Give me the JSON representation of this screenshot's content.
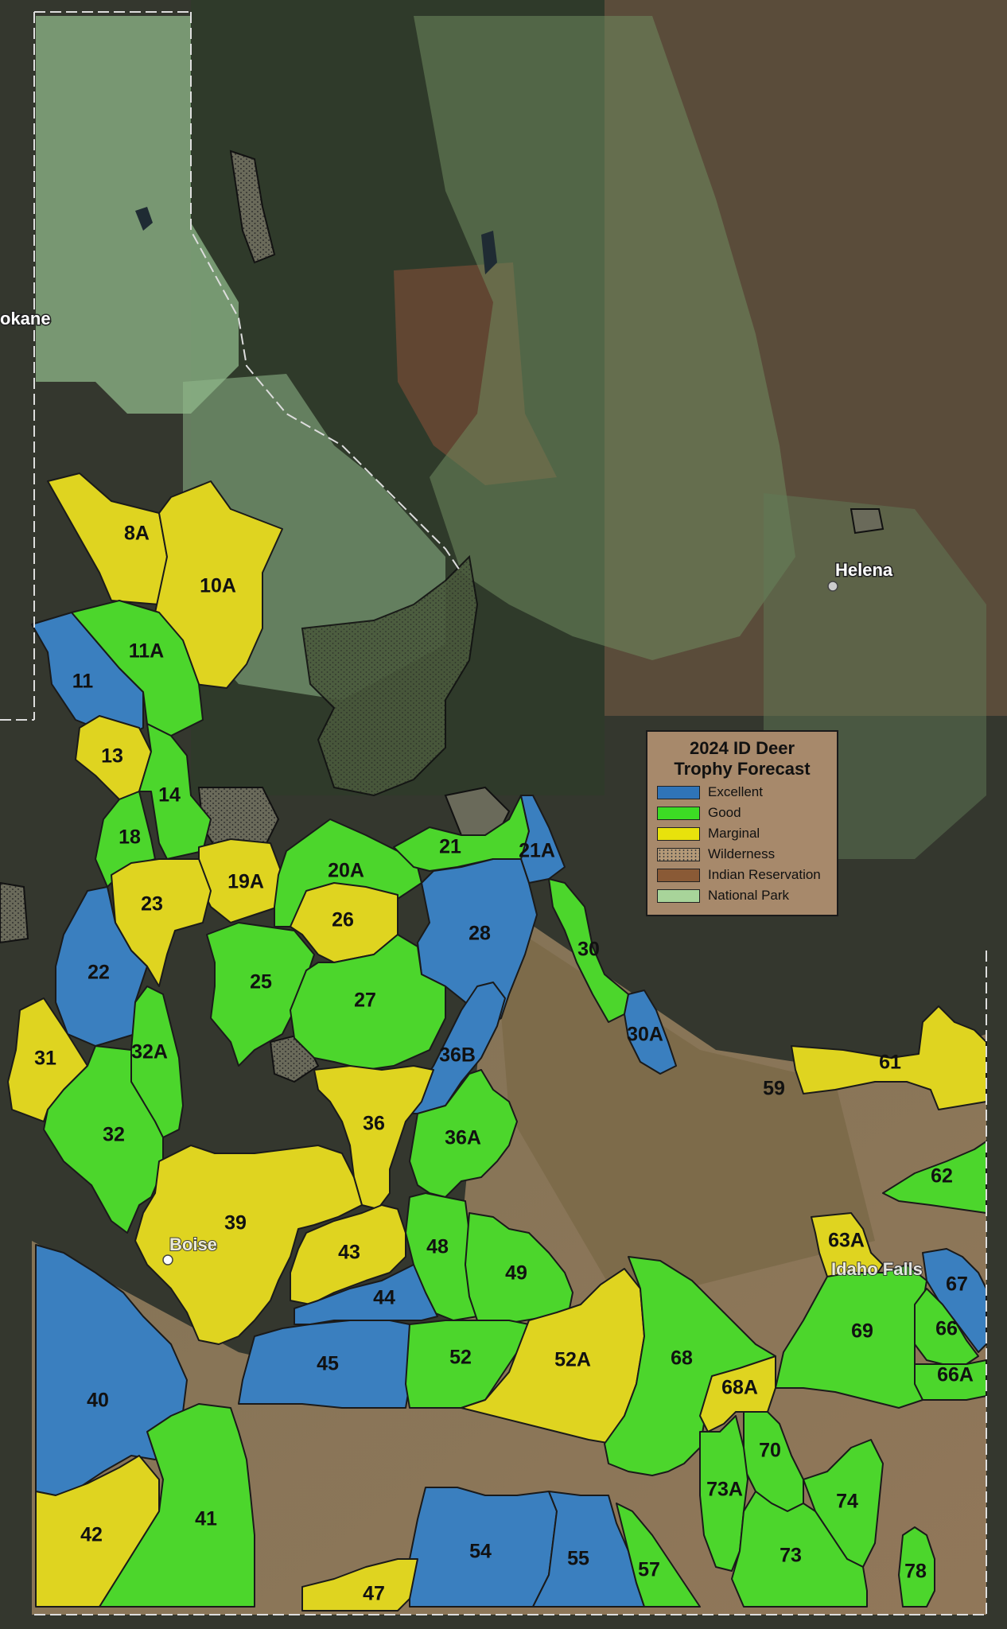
{
  "legend": {
    "title_line1": "2024 ID Deer",
    "title_line2": "Trophy Forecast",
    "items": [
      {
        "label": "Excellent",
        "color": "#2f74b8"
      },
      {
        "label": "Good",
        "color": "#3cdc24"
      },
      {
        "label": "Marginal",
        "color": "#e8e20c"
      },
      {
        "label": "Wilderness",
        "color": "#b59a78"
      },
      {
        "label": "Indian Reservation",
        "color": "#8a5a36"
      },
      {
        "label": "National Park",
        "color": "#a8d49a"
      }
    ]
  },
  "cities": {
    "spokane": "okane",
    "helena": "Helena",
    "boise": "Boise",
    "idaho_falls": "Idaho Falls"
  },
  "colors": {
    "excellent": "#3a7fbf",
    "good": "#4cd62c",
    "marginal": "#dfd420",
    "national_forest_overlay": "#8fb88a",
    "background": "#3b3d33"
  },
  "units": [
    {
      "id": "8A",
      "rating": "marginal"
    },
    {
      "id": "10A",
      "rating": "marginal"
    },
    {
      "id": "11A",
      "rating": "good"
    },
    {
      "id": "11",
      "rating": "excellent"
    },
    {
      "id": "13",
      "rating": "marginal"
    },
    {
      "id": "14",
      "rating": "good"
    },
    {
      "id": "18",
      "rating": "good"
    },
    {
      "id": "19A",
      "rating": "marginal"
    },
    {
      "id": "20A",
      "rating": "good"
    },
    {
      "id": "21",
      "rating": "good"
    },
    {
      "id": "21A",
      "rating": "excellent"
    },
    {
      "id": "23",
      "rating": "marginal"
    },
    {
      "id": "22",
      "rating": "excellent"
    },
    {
      "id": "26",
      "rating": "marginal"
    },
    {
      "id": "28",
      "rating": "excellent"
    },
    {
      "id": "30",
      "rating": "good"
    },
    {
      "id": "25",
      "rating": "good"
    },
    {
      "id": "27",
      "rating": "good"
    },
    {
      "id": "30A",
      "rating": "excellent"
    },
    {
      "id": "31",
      "rating": "marginal"
    },
    {
      "id": "32A",
      "rating": "good"
    },
    {
      "id": "36B",
      "rating": "excellent"
    },
    {
      "id": "61",
      "rating": "marginal"
    },
    {
      "id": "59",
      "rating": "none"
    },
    {
      "id": "32",
      "rating": "good"
    },
    {
      "id": "36",
      "rating": "marginal"
    },
    {
      "id": "36A",
      "rating": "good"
    },
    {
      "id": "62",
      "rating": "good"
    },
    {
      "id": "39",
      "rating": "marginal"
    },
    {
      "id": "63A",
      "rating": "marginal"
    },
    {
      "id": "43",
      "rating": "marginal"
    },
    {
      "id": "48",
      "rating": "good"
    },
    {
      "id": "49",
      "rating": "good"
    },
    {
      "id": "67",
      "rating": "excellent"
    },
    {
      "id": "44",
      "rating": "excellent"
    },
    {
      "id": "69",
      "rating": "good"
    },
    {
      "id": "66",
      "rating": "good"
    },
    {
      "id": "45",
      "rating": "excellent"
    },
    {
      "id": "52",
      "rating": "good"
    },
    {
      "id": "52A",
      "rating": "marginal"
    },
    {
      "id": "68",
      "rating": "good"
    },
    {
      "id": "66A",
      "rating": "good"
    },
    {
      "id": "68A",
      "rating": "marginal"
    },
    {
      "id": "40",
      "rating": "excellent"
    },
    {
      "id": "70",
      "rating": "good"
    },
    {
      "id": "73A",
      "rating": "good"
    },
    {
      "id": "74",
      "rating": "good"
    },
    {
      "id": "41",
      "rating": "good"
    },
    {
      "id": "42",
      "rating": "marginal"
    },
    {
      "id": "54",
      "rating": "excellent"
    },
    {
      "id": "55",
      "rating": "excellent"
    },
    {
      "id": "57",
      "rating": "good"
    },
    {
      "id": "73",
      "rating": "good"
    },
    {
      "id": "78",
      "rating": "good"
    },
    {
      "id": "47",
      "rating": "marginal"
    }
  ]
}
